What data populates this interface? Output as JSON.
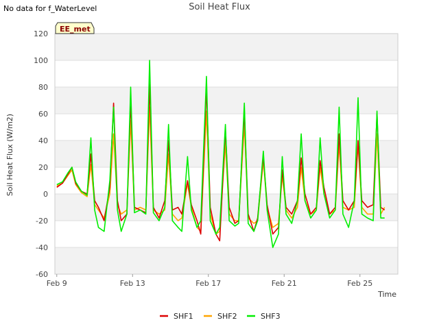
{
  "top_note": "No data for f_WaterLevel",
  "chart_data": {
    "type": "line",
    "title": "Soil Heat Flux",
    "xlabel": "Time",
    "ylabel": "Soil Heat Flux (W/m2)",
    "badge": "EE_met",
    "ylim": [
      -60,
      120
    ],
    "yticks": [
      -60,
      -40,
      -20,
      0,
      20,
      40,
      60,
      80,
      100,
      120
    ],
    "xlim": [
      "Feb 9",
      "Feb 27"
    ],
    "xticks": [
      "Feb 9",
      "Feb 13",
      "Feb 17",
      "Feb 21",
      "Feb 25"
    ],
    "xtick_days": [
      9,
      13,
      17,
      21,
      25
    ],
    "grid": "horizontal bands",
    "legend_position": "bottom-center",
    "x": [
      9.0,
      9.3,
      9.6,
      9.8,
      10.0,
      10.3,
      10.6,
      10.8,
      11.0,
      11.2,
      11.5,
      11.8,
      12.0,
      12.2,
      12.4,
      12.7,
      12.9,
      13.1,
      13.4,
      13.7,
      13.9,
      14.1,
      14.4,
      14.7,
      14.9,
      15.1,
      15.4,
      15.6,
      15.9,
      16.1,
      16.4,
      16.6,
      16.9,
      17.1,
      17.4,
      17.6,
      17.9,
      18.1,
      18.4,
      18.6,
      18.9,
      19.1,
      19.4,
      19.6,
      19.9,
      20.1,
      20.4,
      20.7,
      20.9,
      21.1,
      21.4,
      21.7,
      21.9,
      22.1,
      22.4,
      22.7,
      22.9,
      23.1,
      23.4,
      23.7,
      23.9,
      24.1,
      24.4,
      24.7,
      24.9,
      25.1,
      25.4,
      25.7,
      25.9,
      26.1,
      26.3
    ],
    "series": [
      {
        "name": "SHF1",
        "color": "#dd0000",
        "values": [
          5,
          8,
          15,
          20,
          8,
          2,
          0,
          30,
          -5,
          -10,
          -20,
          5,
          68,
          -5,
          -20,
          -15,
          70,
          -10,
          -12,
          -14,
          82,
          -10,
          -18,
          -5,
          40,
          -12,
          -10,
          -15,
          10,
          -8,
          -20,
          -30,
          80,
          -10,
          -30,
          -35,
          48,
          -10,
          -22,
          -20,
          62,
          -15,
          -28,
          -18,
          28,
          -8,
          -30,
          -25,
          18,
          -10,
          -15,
          -5,
          27,
          0,
          -15,
          -10,
          25,
          5,
          -15,
          -10,
          45,
          -5,
          -12,
          -5,
          40,
          -5,
          -10,
          -8,
          60,
          -10,
          -12
        ]
      },
      {
        "name": "SHF2",
        "color": "#ffa500",
        "values": [
          6,
          8,
          14,
          18,
          7,
          1,
          -2,
          22,
          -8,
          -12,
          -18,
          0,
          45,
          -8,
          -15,
          -12,
          55,
          -12,
          -10,
          -12,
          65,
          -12,
          -15,
          -12,
          30,
          -15,
          -20,
          -18,
          8,
          -10,
          -25,
          -28,
          62,
          -15,
          -30,
          -28,
          38,
          -15,
          -20,
          -20,
          52,
          -18,
          -22,
          -20,
          25,
          -10,
          -25,
          -22,
          14,
          -12,
          -18,
          -10,
          20,
          -5,
          -15,
          -12,
          20,
          0,
          -15,
          -12,
          38,
          -10,
          -12,
          -10,
          38,
          -10,
          -15,
          -15,
          45,
          -15,
          -10
        ]
      },
      {
        "name": "SHF3",
        "color": "#00ee00",
        "values": [
          7,
          9,
          16,
          20,
          9,
          2,
          -1,
          42,
          -12,
          -25,
          -28,
          10,
          65,
          -12,
          -28,
          -15,
          80,
          -14,
          -12,
          -15,
          100,
          -14,
          -20,
          -10,
          52,
          -20,
          -25,
          -28,
          28,
          -12,
          -25,
          -20,
          88,
          -20,
          -30,
          -25,
          52,
          -20,
          -24,
          -22,
          68,
          -22,
          -28,
          -20,
          32,
          -12,
          -40,
          -30,
          28,
          -15,
          -22,
          -5,
          45,
          -5,
          -18,
          -12,
          42,
          0,
          -18,
          -12,
          65,
          -15,
          -25,
          -5,
          72,
          -15,
          -18,
          -20,
          62,
          -18,
          -18
        ]
      }
    ]
  }
}
